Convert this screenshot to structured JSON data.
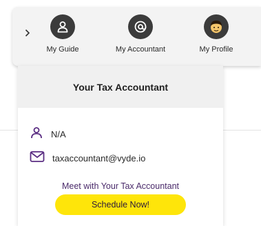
{
  "nav": {
    "items": [
      {
        "label": "My Guide",
        "icon": "person-icon"
      },
      {
        "label": "My Accountant",
        "icon": "at-sign-icon"
      },
      {
        "label": "My Profile",
        "icon": "avatar-icon"
      }
    ]
  },
  "card": {
    "title": "Your Tax Accountant",
    "name": "N/A",
    "email": "taxaccountant@vyde.io",
    "meet_text": "Meet with Your Tax Accountant",
    "schedule_label": "Schedule Now!"
  },
  "colors": {
    "accent_purple": "#5a2d82",
    "button_yellow": "#fee50a",
    "nav_icon_bg": "#3b3b3b"
  }
}
